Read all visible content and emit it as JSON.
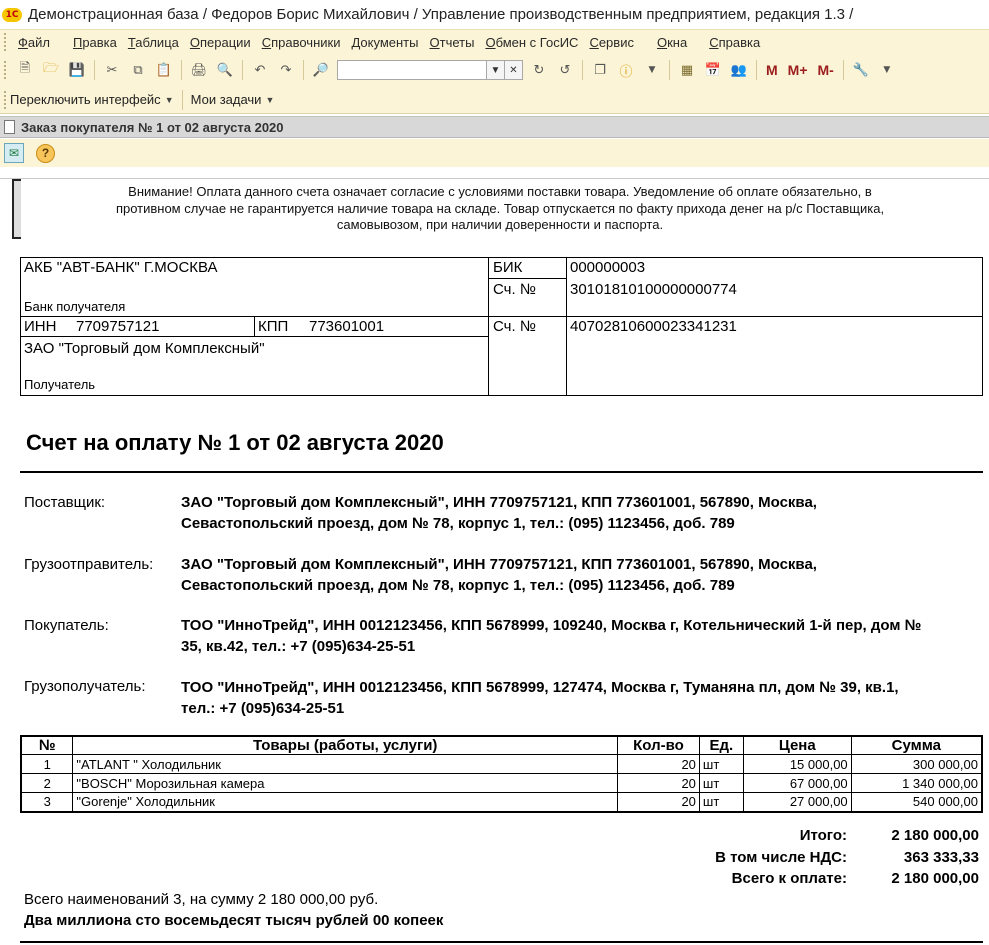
{
  "window": {
    "title": "Демонстрационная база / Федоров Борис Михайлович /  Управление производственным предприятием, редакция 1.3 /",
    "logo_text": "1С"
  },
  "menu": [
    "Файл",
    "Правка",
    "Таблица",
    "Операции",
    "Справочники",
    "Документы",
    "Отчеты",
    "Обмен с ГосИС",
    "Сервис",
    "Окна",
    "Справка"
  ],
  "toolbar": {
    "search_value": "",
    "memory_buttons": [
      "M",
      "M+",
      "M-"
    ]
  },
  "interface_bar": {
    "switch_label": "Переключить интерфейс",
    "tasks_label": "Мои задачи"
  },
  "document": {
    "title": "Заказ покупателя № 1 от 02 августа 2020",
    "notice": "Внимание! Оплата данного счета означает согласие с условиями поставки товара. Уведомление об оплате обязательно, в противном случае не гарантируется наличие товара на складе. Товар отпускается по факту прихода денег на р/с Поставщика, самовывозом, при наличии доверенности и паспорта.",
    "bank": {
      "bank_name": "АКБ \"АВТ-БАНК\" Г.МОСКВА",
      "bank_caption": "Банк получателя",
      "bik_label": "БИК",
      "bik_value": "000000003",
      "corr_label": "Сч. №",
      "corr_value": "30101810100000000774",
      "inn_label": "ИНН",
      "inn_value": "7709757121",
      "kpp_label": "КПП",
      "kpp_value": "773601001",
      "account_label": "Сч. №",
      "account_value": "40702810600023341231",
      "recipient_name": "ЗАО \"Торговый дом Комплексный\"",
      "recipient_caption": "Получатель"
    },
    "invoice_title": "Счет на оплату № 1 от 02 августа 2020",
    "parties": [
      {
        "label": "Поставщик:",
        "line1": "ЗАО \"Торговый дом Комплексный\", ИНН 7709757121, КПП 773601001, 567890, Москва,",
        "line2": "Севастопольский проезд, дом № 78, корпус 1, тел.: (095) 1123456, доб. 789"
      },
      {
        "label": "Грузоотправитель:",
        "line1": "ЗАО \"Торговый дом Комплексный\", ИНН 7709757121, КПП 773601001, 567890, Москва,",
        "line2": "Севастопольский проезд, дом № 78, корпус 1, тел.: (095) 1123456, доб. 789"
      },
      {
        "label": "Покупатель:",
        "line1": "ТОО \"ИнноТрейд\", ИНН 0012123456, КПП 5678999, 109240, Москва г, Котельнический 1-й пер, дом №",
        "line2": "35, кв.42, тел.: +7 (095)634-25-51"
      },
      {
        "label": "Грузополучатель:",
        "line1": "ТОО \"ИнноТрейд\", ИНН 0012123456, КПП 5678999, 127474, Москва г, Туманяна пл, дом № 39, кв.1,",
        "line2": "тел.: +7 (095)634-25-51"
      }
    ],
    "goods": {
      "headers": [
        "№",
        "Товары (работы, услуги)",
        "Кол-во",
        "Ед.",
        "Цена",
        "Сумма"
      ],
      "rows": [
        [
          "1",
          "\"ATLANT \" Холодильник",
          "20",
          "шт",
          "15 000,00",
          "300 000,00"
        ],
        [
          "2",
          "\"BOSCH\" Морозильная камера",
          "20",
          "шт",
          "67 000,00",
          "1 340 000,00"
        ],
        [
          "3",
          "\"Gorenje\" Холодильник",
          "20",
          "шт",
          "27 000,00",
          "540 000,00"
        ]
      ]
    },
    "totals": {
      "total_label": "Итого:",
      "total_value": "2 180 000,00",
      "vat_label": "В том числе НДС:",
      "vat_value": "363 333,33",
      "pay_label": "Всего к оплате:",
      "pay_value": "2 180 000,00"
    },
    "summary_count": "Всего наименований 3, на сумму 2 180 000,00 руб.",
    "summary_words": "Два миллиона сто восемьдесят тысяч рублей 00 копеек"
  }
}
